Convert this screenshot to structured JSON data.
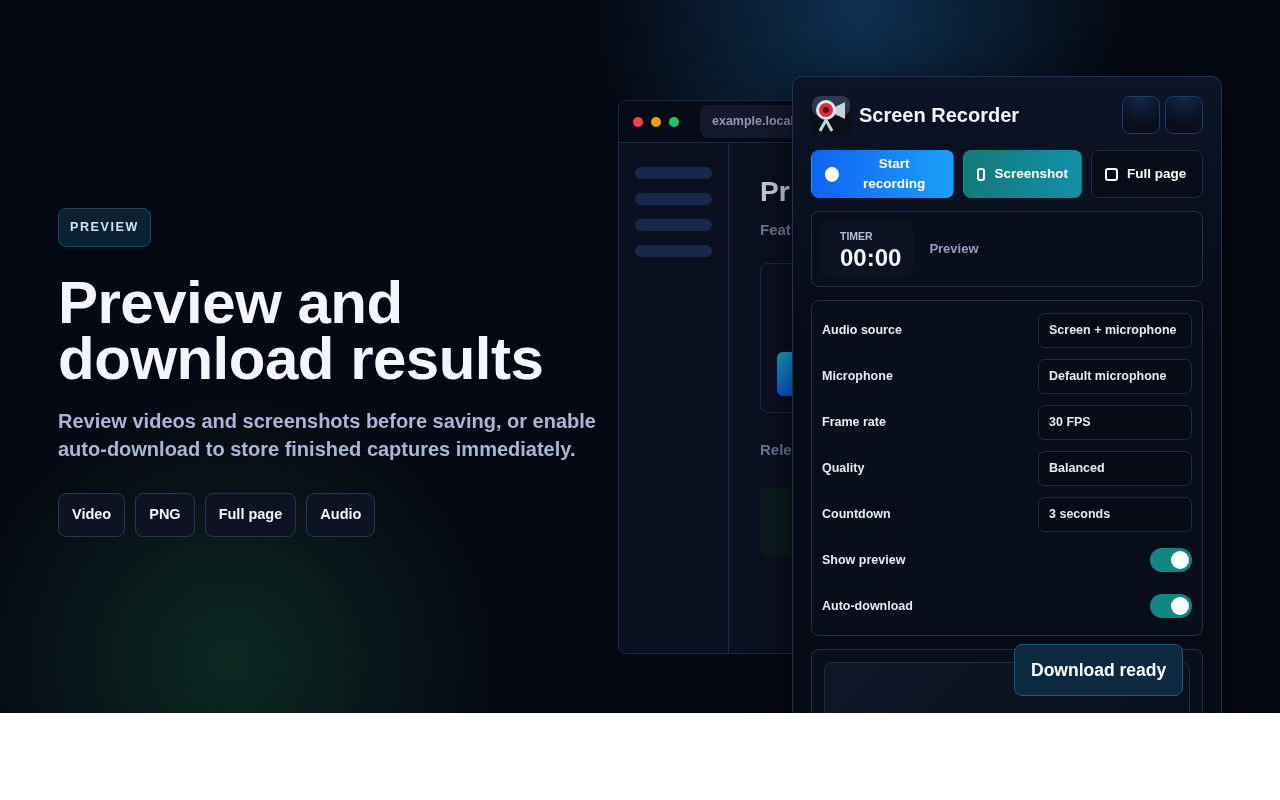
{
  "hero": {
    "badge": "PREVIEW",
    "title": "Preview and download results",
    "subtitle": "Review videos and screenshots before saving, or enable auto-download to store finished captures immediately.",
    "chips": [
      "Video",
      "PNG",
      "Full page",
      "Audio"
    ]
  },
  "browser": {
    "url": "example.local",
    "heading": "Pr",
    "subheading": "Feat",
    "section": "Rele"
  },
  "recorder": {
    "title": "Screen Recorder",
    "actions": [
      {
        "label": "Start recording",
        "kind": "record"
      },
      {
        "label": "Screenshot",
        "kind": "screenshot"
      },
      {
        "label": "Full page",
        "kind": "fullpage"
      }
    ],
    "timer": {
      "label": "TIMER",
      "value": "00:00"
    },
    "preview_label": "Preview",
    "settings": [
      {
        "kind": "select",
        "label": "Audio source",
        "value": "Screen + microphone"
      },
      {
        "kind": "select",
        "label": "Microphone",
        "value": "Default microphone"
      },
      {
        "kind": "select",
        "label": "Frame rate",
        "value": "30 FPS"
      },
      {
        "kind": "select",
        "label": "Quality",
        "value": "Balanced"
      },
      {
        "kind": "select",
        "label": "Countdown",
        "value": "3 seconds"
      },
      {
        "kind": "toggle",
        "label": "Show preview",
        "on": true
      },
      {
        "kind": "toggle",
        "label": "Auto-download",
        "on": true
      }
    ],
    "toast": "Download ready"
  }
}
